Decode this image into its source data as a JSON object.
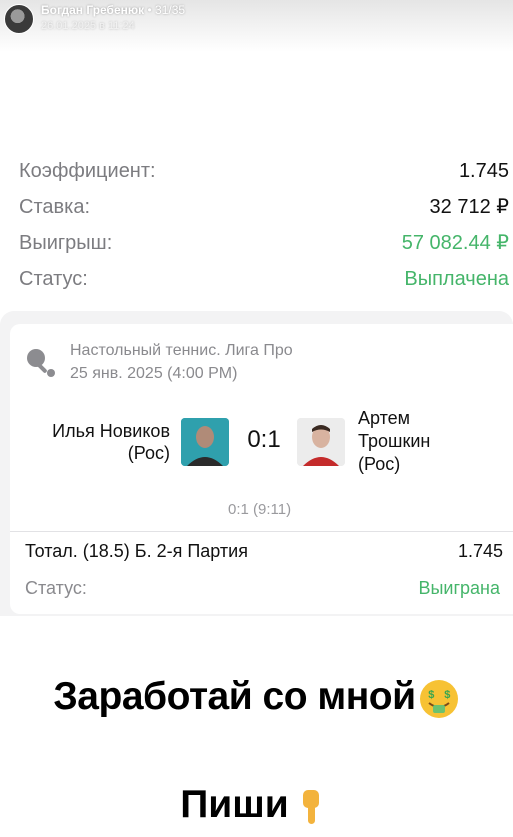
{
  "story": {
    "author": "Богдан Гребенюк",
    "separator": " • ",
    "counter": "31/35",
    "date": "26.01.2025 в 11:24"
  },
  "bet_summary": {
    "rows": [
      {
        "label": "Коэффициент:",
        "value": "1.745"
      },
      {
        "label": "Ставка:",
        "value": "32 712 ₽"
      },
      {
        "label": "Выигрыш:",
        "value": "57 082.44 ₽"
      },
      {
        "label": "Статус:",
        "value": "Выплачена"
      }
    ]
  },
  "match": {
    "sport_icon": "ping-pong-icon",
    "league": "Настольный теннис. Лига Про",
    "date": "25 янв. 2025 (4:00 PM)",
    "player1": {
      "name_line1": "Илья Новиков",
      "name_line2": "(Рос)"
    },
    "player2": {
      "name_line1": "Артем",
      "name_line2": "Трошкин",
      "name_line3": "(Рос)"
    },
    "score": "0:1",
    "set_score": "0:1 (9:11)",
    "market": "Тотал. (18.5) Б. 2-я Партия",
    "odds": "1.745",
    "status_label": "Статус:",
    "status_value": "Выиграна"
  },
  "captions": {
    "line1": "Заработай со мной",
    "line1_emoji": "money-mouth-face-emoji",
    "line2": "Пиши",
    "line2_emoji": "pointing-down-hand-emoji"
  },
  "colors": {
    "green": "#45b56a",
    "muted": "#7c7c80"
  }
}
